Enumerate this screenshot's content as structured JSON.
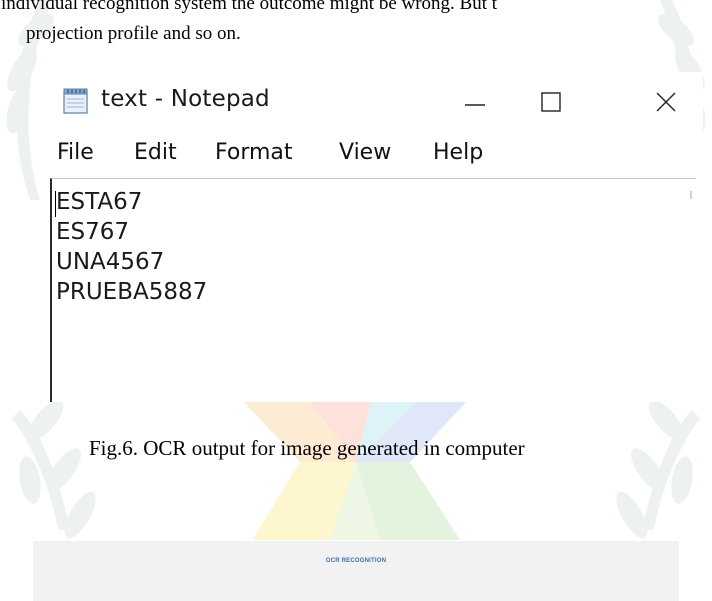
{
  "paper": {
    "paragraph_line1": "individual recognition system the outcome might be wrong. But t",
    "paragraph_line2": "projection profile and so on.",
    "figure_caption": "Fig.6. OCR output for image generated in computer"
  },
  "notepad": {
    "title": "text - Notepad",
    "icon": "notepad-icon",
    "controls": {
      "minimize_icon": "minimize-icon",
      "maximize_icon": "maximize-icon",
      "close_icon": "close-icon"
    },
    "menu": [
      "File",
      "Edit",
      "Format",
      "View",
      "Help"
    ],
    "content_lines": [
      "ESTA67",
      "ES767",
      "UNA4567",
      "PRUEBA5887"
    ]
  },
  "ocr_app": {
    "title": "OCR RECOGNITION"
  },
  "colors": {
    "watermark_leaves": "#eef2ef",
    "pinwheel_red": "#fde2dc",
    "pinwheel_orange": "#fdebd3",
    "pinwheel_yellow": "#fdf6cf",
    "pinwheel_green": "#e3f3de",
    "pinwheel_cyan": "#ddf3f8",
    "pinwheel_blue": "#dfe7f8",
    "ocr_title": "#3a6fb0"
  }
}
